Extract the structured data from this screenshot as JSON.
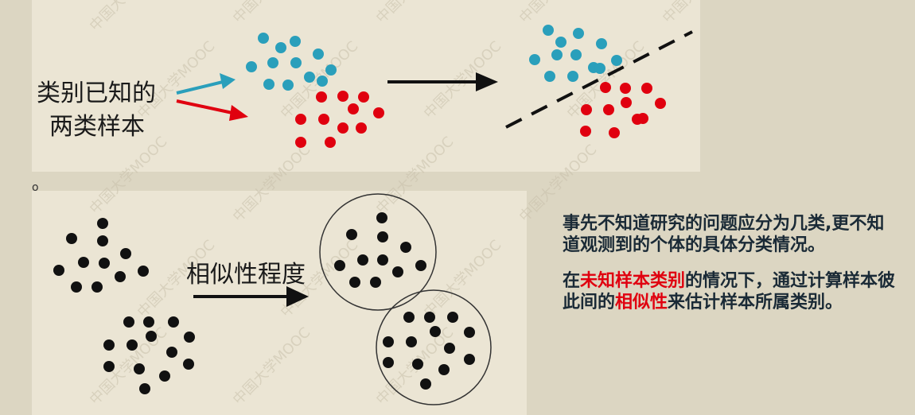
{
  "top": {
    "label_line1": "类别已知的",
    "label_line2": "两类样本"
  },
  "bottom": {
    "arrow_label": "相似性程度",
    "small_mark": "o"
  },
  "description": {
    "para1": "事先不知道研究的问题应分为几类,更不知道观测到的个体的具体分类情况。",
    "para2_part1": "在",
    "para2_highlight1": "未知样本类别",
    "para2_part2": "的情况下，通过计算样本彼此间的",
    "para2_highlight2": "相似性",
    "para2_part3": "来估计样本所属类别。"
  },
  "watermark": "中国大学MOOC",
  "colors": {
    "blue_dot": "#2a9fbb",
    "red_dot": "#e0000f",
    "black_dot": "#111111",
    "highlight_text": "#e0000f"
  }
}
